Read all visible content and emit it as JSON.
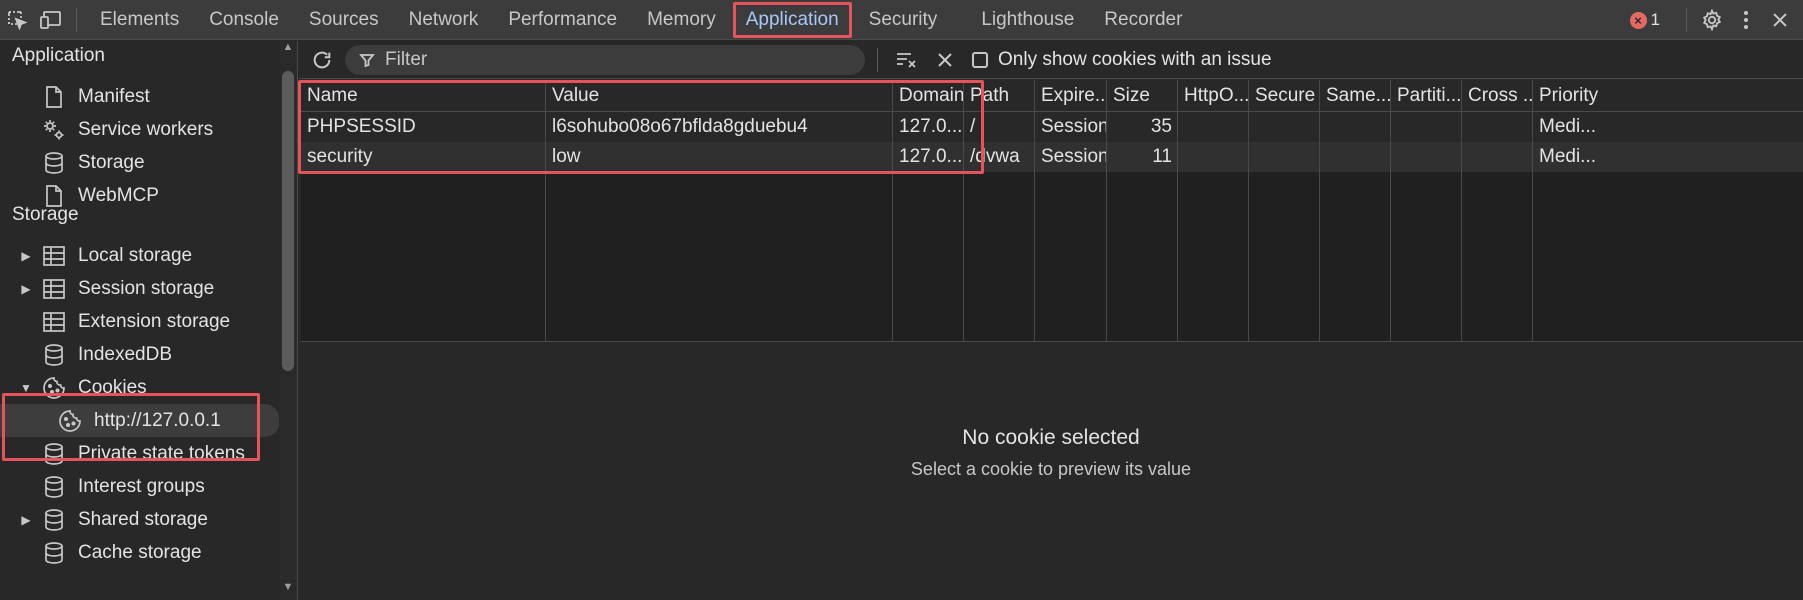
{
  "toolbar": {
    "tabs": [
      {
        "label": "Elements"
      },
      {
        "label": "Console"
      },
      {
        "label": "Sources"
      },
      {
        "label": "Network"
      },
      {
        "label": "Performance"
      },
      {
        "label": "Memory"
      },
      {
        "label": "Application",
        "active": true
      },
      {
        "label": "Security"
      },
      {
        "label": "Lighthouse"
      },
      {
        "label": "Recorder"
      }
    ],
    "error_count": "1"
  },
  "sidebar": {
    "application_title": "Application",
    "application_items": [
      {
        "label": "Manifest",
        "icon": "document-icon"
      },
      {
        "label": "Service workers",
        "icon": "gears-icon"
      },
      {
        "label": "Storage",
        "icon": "database-icon"
      },
      {
        "label": "WebMCP",
        "icon": "document-icon"
      }
    ],
    "storage_title": "Storage",
    "storage_items": [
      {
        "label": "Local storage",
        "icon": "table-icon",
        "expandable": true
      },
      {
        "label": "Session storage",
        "icon": "table-icon",
        "expandable": true
      },
      {
        "label": "Extension storage",
        "icon": "table-icon"
      },
      {
        "label": "IndexedDB",
        "icon": "database-icon"
      },
      {
        "label": "Cookies",
        "icon": "cookie-icon",
        "expanded": true
      },
      {
        "label": "http://127.0.0.1",
        "icon": "cookie-icon",
        "selected": true
      },
      {
        "label": "Private state tokens",
        "icon": "database-icon"
      },
      {
        "label": "Interest groups",
        "icon": "database-icon"
      },
      {
        "label": "Shared storage",
        "icon": "database-icon",
        "expandable": true
      },
      {
        "label": "Cache storage",
        "icon": "database-icon"
      }
    ]
  },
  "filter": {
    "placeholder": "Filter",
    "only_issue_label": "Only show cookies with an issue"
  },
  "table": {
    "columns": [
      "Name",
      "Value",
      "Domain",
      "Path",
      "Expire...",
      "Size",
      "HttpO...",
      "Secure",
      "Same...",
      "Partiti...",
      "Cross ...",
      "Priority"
    ],
    "rows": [
      [
        "PHPSESSID",
        "l6sohubo08o67bflda8gduebu4",
        "127.0....",
        "/",
        "Session",
        "35",
        "",
        "",
        "",
        "",
        "",
        "Medi..."
      ],
      [
        "security",
        "low",
        "127.0....",
        "/dvwa",
        "Session",
        "11",
        "",
        "",
        "",
        "",
        "",
        "Medi..."
      ]
    ]
  },
  "preview": {
    "title": "No cookie selected",
    "subtitle": "Select a cookie to preview its value"
  },
  "colors": {
    "accent": "#a8c7fa",
    "highlight": "#e8525a",
    "error": "#e46962"
  }
}
